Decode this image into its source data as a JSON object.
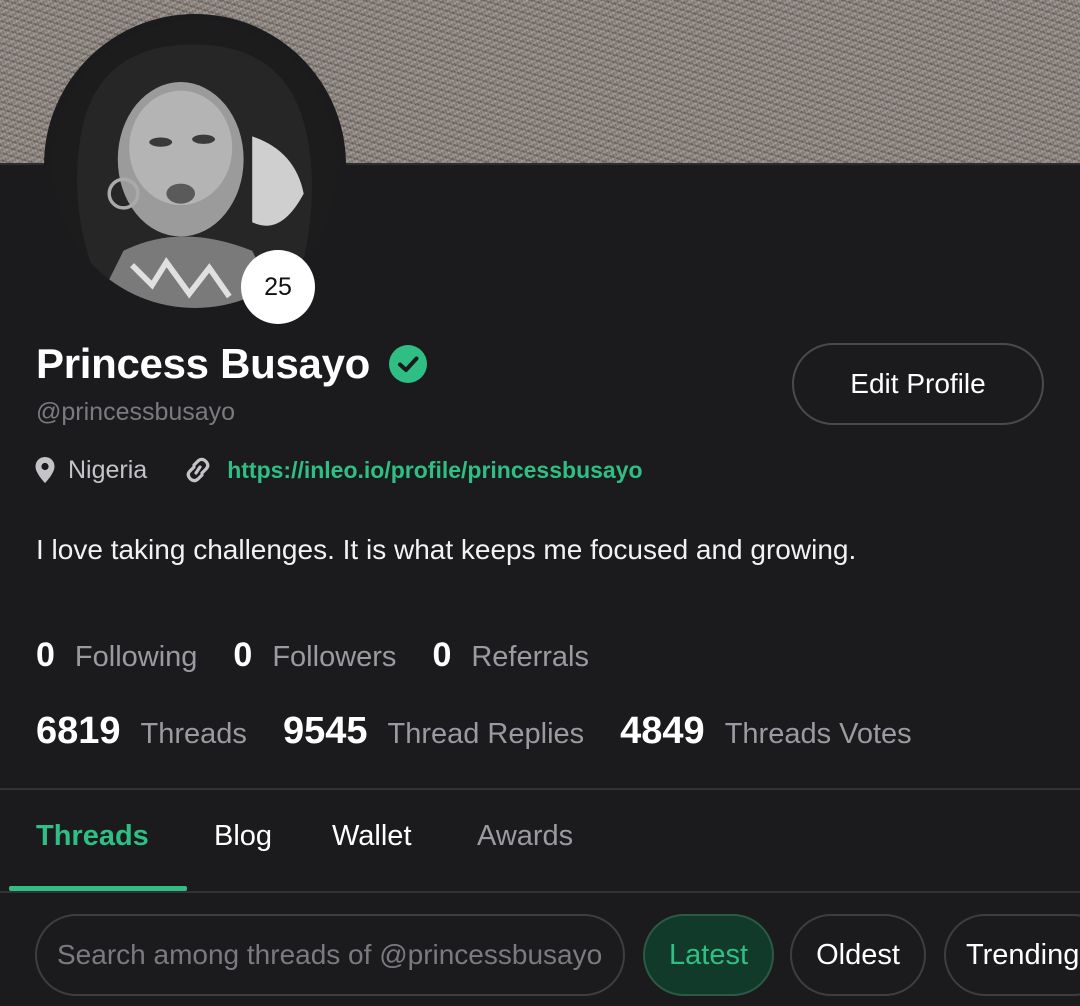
{
  "profile": {
    "name": "Princess Busayo",
    "handle": "@princessbusayo",
    "level": "25",
    "location": "Nigeria",
    "link": "https://inleo.io/profile/princessbusayo",
    "bio": "I love taking challenges. It is what keeps me focused and growing.",
    "edit_label": "Edit Profile"
  },
  "stats": {
    "following": {
      "count": "0",
      "label": "Following"
    },
    "followers": {
      "count": "0",
      "label": "Followers"
    },
    "referrals": {
      "count": "0",
      "label": "Referrals"
    },
    "threads": {
      "count": "6819",
      "label": "Threads"
    },
    "replies": {
      "count": "9545",
      "label": "Thread Replies"
    },
    "votes": {
      "count": "4849",
      "label": "Threads Votes"
    }
  },
  "tabs": [
    {
      "label": "Threads",
      "active": true
    },
    {
      "label": "Blog"
    },
    {
      "label": "Wallet"
    },
    {
      "label": "Awards"
    }
  ],
  "search": {
    "placeholder": "Search among threads of @princessbusayo"
  },
  "sort": {
    "latest": "Latest",
    "oldest": "Oldest",
    "trending": "Trending"
  },
  "icons": {
    "verified": "check-badge-icon",
    "location": "map-pin-icon",
    "link": "link-icon"
  },
  "colors": {
    "accent": "#2fbf84",
    "background": "#1b1b1d",
    "muted": "#9a9aa0"
  }
}
